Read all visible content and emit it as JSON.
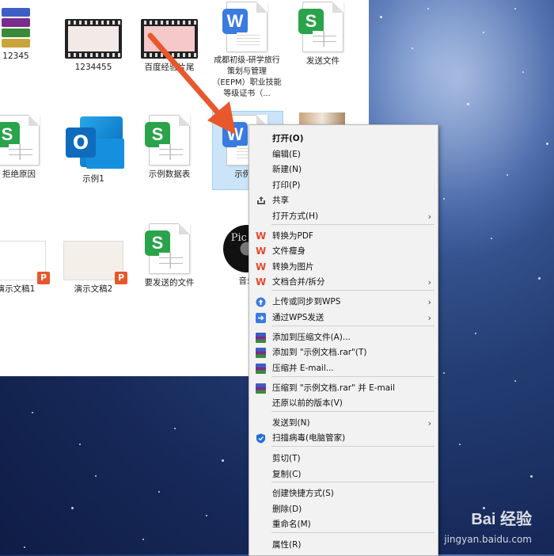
{
  "files": [
    {
      "label": "12345",
      "type": "rar"
    },
    {
      "label": "1234455",
      "type": "video"
    },
    {
      "label": "百度经验片尾",
      "type": "video"
    },
    {
      "label": "成都初级-研学旅行策划与管理（EEPM）职业技能等级证书（...",
      "type": "wps-word"
    },
    {
      "label": "发送文件",
      "type": "wps-sheet"
    },
    {
      "label": "拒绝原因",
      "type": "wps-sheet"
    },
    {
      "label": "示例1",
      "type": "outlook"
    },
    {
      "label": "示例数据表",
      "type": "wps-sheet"
    },
    {
      "label": "示例文",
      "type": "wps-word"
    },
    {
      "label": "演示文稿1",
      "type": "wps-ppt"
    },
    {
      "label": "演示文稿2",
      "type": "wps-ppt"
    },
    {
      "label": "要发送的文件",
      "type": "wps-sheet"
    },
    {
      "label": "音乐",
      "type": "audio"
    }
  ],
  "icons": {
    "wps_sheet_letter": "S",
    "wps_word_letter": "W",
    "wps_ppt_letter": "P",
    "outlook_letter": "O",
    "disc_text": "Pic bo"
  },
  "context_menu": {
    "items": [
      {
        "label": "打开(O)",
        "icon": "",
        "submenu": false
      },
      {
        "label": "编辑(E)",
        "icon": "",
        "submenu": false
      },
      {
        "label": "新建(N)",
        "icon": "",
        "submenu": false
      },
      {
        "label": "打印(P)",
        "icon": "",
        "submenu": false
      },
      {
        "label": "共享",
        "icon": "share-icon",
        "submenu": false
      },
      {
        "label": "打开方式(H)",
        "icon": "",
        "submenu": true
      },
      {
        "label": "转换为PDF",
        "icon": "wps-icon",
        "submenu": false
      },
      {
        "label": "文件瘦身",
        "icon": "wps-icon",
        "submenu": false
      },
      {
        "label": "转换为图片",
        "icon": "wps-icon",
        "submenu": false
      },
      {
        "label": "文档合并/拆分",
        "icon": "wps-icon",
        "submenu": true
      },
      {
        "label": "上传或同步到WPS",
        "icon": "cloud-upload-icon",
        "submenu": true
      },
      {
        "label": "通过WPS发送",
        "icon": "send-icon",
        "submenu": true
      },
      {
        "label": "添加到压缩文件(A)...",
        "icon": "winrar-icon",
        "submenu": false
      },
      {
        "label": "添加到 \"示例文档.rar\"(T)",
        "icon": "winrar-icon",
        "submenu": false
      },
      {
        "label": "压缩并 E-mail...",
        "icon": "winrar-icon",
        "submenu": false
      },
      {
        "label": "压缩到 \"示例文档.rar\" 并 E-mail",
        "icon": "winrar-icon",
        "submenu": false
      },
      {
        "label": "还原以前的版本(V)",
        "icon": "",
        "submenu": false
      },
      {
        "label": "发送到(N)",
        "icon": "",
        "submenu": true
      },
      {
        "label": "扫描病毒(电脑管家)",
        "icon": "shield-icon",
        "submenu": false
      },
      {
        "label": "剪切(T)",
        "icon": "",
        "submenu": false
      },
      {
        "label": "复制(C)",
        "icon": "",
        "submenu": false
      },
      {
        "label": "创建快捷方式(S)",
        "icon": "",
        "submenu": false
      },
      {
        "label": "删除(D)",
        "icon": "",
        "submenu": false
      },
      {
        "label": "重命名(M)",
        "icon": "",
        "submenu": false
      },
      {
        "label": "属性(R)",
        "icon": "",
        "submenu": false
      }
    ],
    "submenu_glyph": "›"
  },
  "watermark": {
    "brand": "Bai 经验",
    "url": "jingyan.baidu.com"
  },
  "colors": {
    "arrow": "#e8582c",
    "selection": "#cce4f7",
    "wps_sheet": "#2aa34a",
    "wps_word": "#3a7be0",
    "wps_red": "#e24a2f"
  }
}
